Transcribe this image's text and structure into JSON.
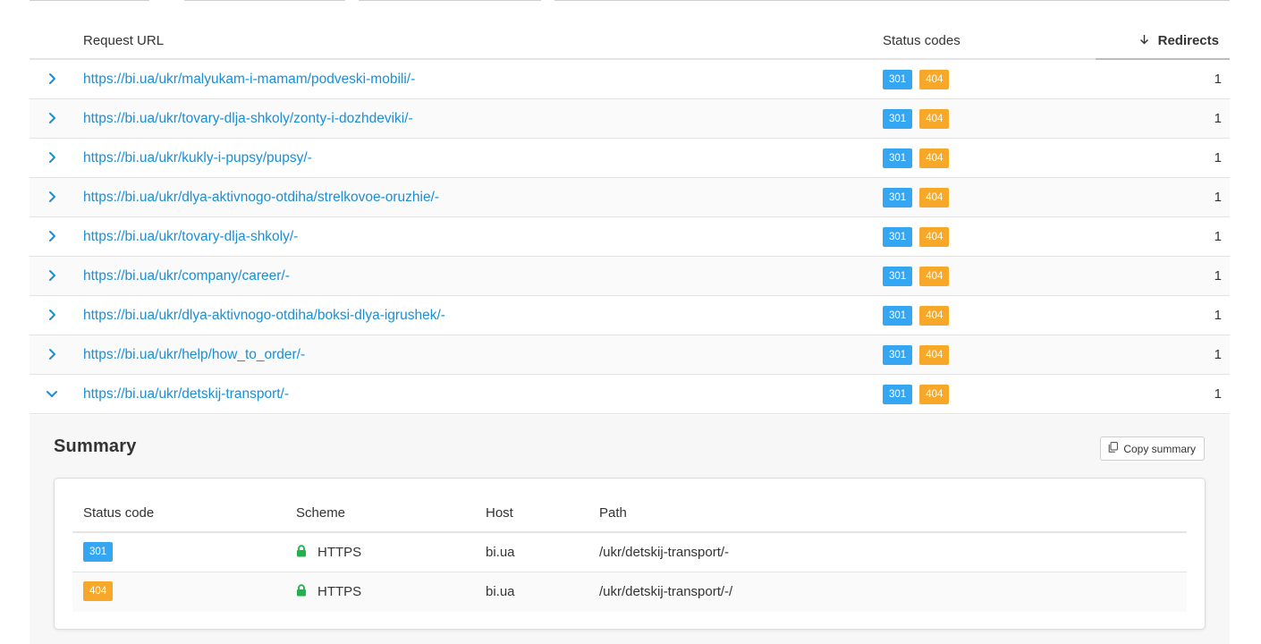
{
  "colors": {
    "link": "#1a8fd6",
    "status_301": "#35a7f2",
    "status_404": "#f7a828",
    "lock": "#22b14c"
  },
  "table": {
    "headers": {
      "request_url": "Request URL",
      "status_codes": "Status codes",
      "redirects": "Redirects"
    },
    "rows": [
      {
        "url": "https://bi.ua/ukr/malyukam-i-mamam/podveski-mobili/-",
        "codes": [
          "301",
          "404"
        ],
        "redirects": "1",
        "expanded": false
      },
      {
        "url": "https://bi.ua/ukr/tovary-dlja-shkoly/zonty-i-dozhdeviki/-",
        "codes": [
          "301",
          "404"
        ],
        "redirects": "1",
        "expanded": false
      },
      {
        "url": "https://bi.ua/ukr/kukly-i-pupsy/pupsy/-",
        "codes": [
          "301",
          "404"
        ],
        "redirects": "1",
        "expanded": false
      },
      {
        "url": "https://bi.ua/ukr/dlya-aktivnogo-otdiha/strelkovoe-oruzhie/-",
        "codes": [
          "301",
          "404"
        ],
        "redirects": "1",
        "expanded": false
      },
      {
        "url": "https://bi.ua/ukr/tovary-dlja-shkoly/-",
        "codes": [
          "301",
          "404"
        ],
        "redirects": "1",
        "expanded": false
      },
      {
        "url": "https://bi.ua/ukr/company/career/-",
        "codes": [
          "301",
          "404"
        ],
        "redirects": "1",
        "expanded": false
      },
      {
        "url": "https://bi.ua/ukr/dlya-aktivnogo-otdiha/boksi-dlya-igrushek/-",
        "codes": [
          "301",
          "404"
        ],
        "redirects": "1",
        "expanded": false
      },
      {
        "url": "https://bi.ua/ukr/help/how_to_order/-",
        "codes": [
          "301",
          "404"
        ],
        "redirects": "1",
        "expanded": false
      },
      {
        "url": "https://bi.ua/ukr/detskij-transport/-",
        "codes": [
          "301",
          "404"
        ],
        "redirects": "1",
        "expanded": true
      }
    ]
  },
  "summary": {
    "title": "Summary",
    "copy_label": "Copy summary",
    "headers": {
      "status_code": "Status code",
      "scheme": "Scheme",
      "host": "Host",
      "path": "Path"
    },
    "rows": [
      {
        "status_code": "301",
        "scheme": "HTTPS",
        "host": "bi.ua",
        "path": "/ukr/detskij-transport/-"
      },
      {
        "status_code": "404",
        "scheme": "HTTPS",
        "host": "bi.ua",
        "path": "/ukr/detskij-transport/-/"
      }
    ]
  },
  "icons": {
    "expand": "chevron-right-icon",
    "collapse": "chevron-down-icon",
    "sort": "arrow-down-icon",
    "copy": "copy-icon",
    "scheme": "lock-icon"
  }
}
